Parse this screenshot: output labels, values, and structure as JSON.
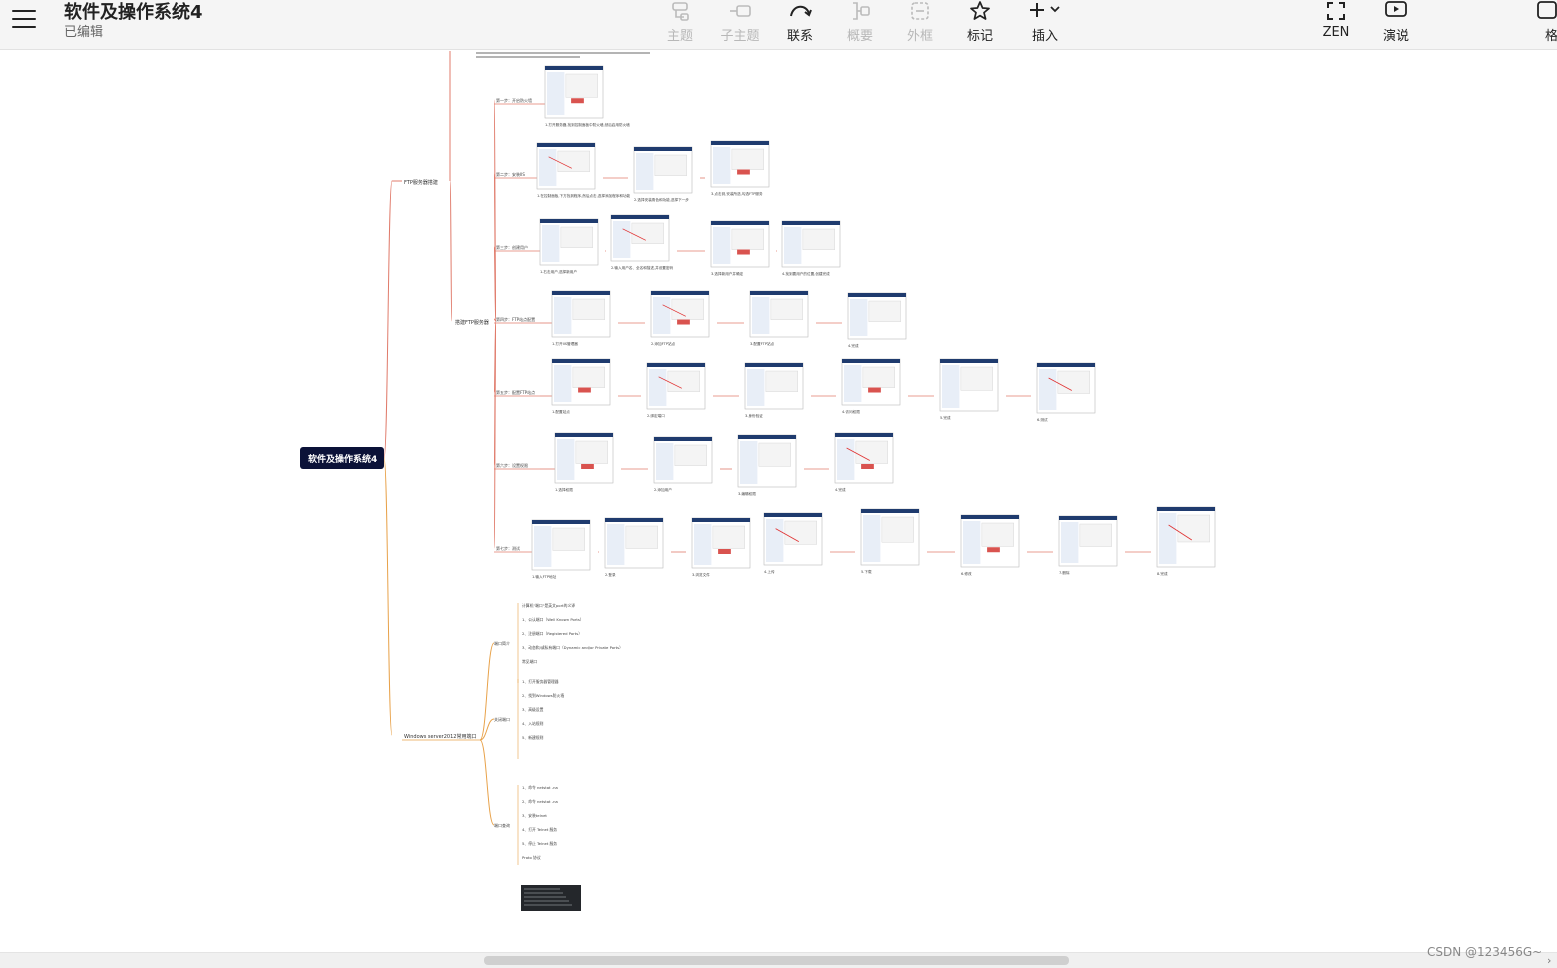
{
  "header": {
    "title": "软件及操作系统4",
    "status": "已编辑"
  },
  "toolbar": {
    "items": [
      {
        "label": "主题",
        "icon": "topic-icon",
        "enabled": false
      },
      {
        "label": "子主题",
        "icon": "subtopic-icon",
        "enabled": false
      },
      {
        "label": "联系",
        "icon": "relationship-icon",
        "enabled": true
      },
      {
        "label": "概要",
        "icon": "summary-icon",
        "enabled": false
      },
      {
        "label": "外框",
        "icon": "boundary-icon",
        "enabled": false
      },
      {
        "label": "标记",
        "icon": "star-icon",
        "enabled": true
      },
      {
        "label": "插入",
        "icon": "plus-icon",
        "enabled": true
      }
    ],
    "right_items": [
      {
        "label": "ZEN",
        "icon": "fullscreen-icon"
      },
      {
        "label": "演说",
        "icon": "presentation-icon"
      }
    ],
    "edge_label": "格"
  },
  "mindmap": {
    "root": "软件及操作系统4",
    "branches": [
      {
        "label": "FTP服务器搭建",
        "sub": "搭建FTP服务器",
        "steps": [
          {
            "label": "第一步：开启防火墙",
            "captions": [
              "1.打开服务器,找到控制面板中防火墙,然后启用防火墙"
            ]
          },
          {
            "label": "第二步：安装IIS",
            "captions": [
              "1.在控制面板,下方找到程序,然后点击,选择添加程序和功能",
              "2.选择安装角色和功能,选择下一步",
              "3.点击到,安装所选,勾选FTP服务"
            ]
          },
          {
            "label": "第三步：创建用户",
            "captions": [
              "1.右击用户,选择新用户",
              "2.输入用户名、全名和描述,并设置密码",
              "3.选择新用户并确定",
              "4.找到要用户的位置,创建完成"
            ]
          },
          {
            "label": "第四步：FTP站点配置",
            "captions": [
              "1.打开IIS管理器",
              "2.添加FTP站点",
              "3.配置FTP站点",
              "4.完成"
            ]
          },
          {
            "label": "第五步：配置FTP站点",
            "captions": [
              "1.配置站点",
              "2.绑定端口",
              "3.身份验证",
              "4.访问权限",
              "5.完成",
              "6.测试"
            ]
          },
          {
            "label": "第六步：设置权限",
            "captions": [
              "1.选择权限",
              "2.添加用户",
              "3.编辑权限",
              "4.完成"
            ]
          },
          {
            "label": "第七步：测试",
            "captions": [
              "1.输入FTP地址",
              "2.登录",
              "3.浏览文件",
              "4.上传",
              "5.下载",
              "6.修改",
              "7.删除",
              "8.完成"
            ]
          }
        ]
      },
      {
        "label": "Windows server2012常用端口",
        "groups": [
          {
            "label": "端口简介",
            "lines": [
              "计算机\"端口\"是英文port的义译",
              "1、公认端口（Well Known Ports）",
              "2、注册端口（Registered Ports）",
              "3、动态和/或私有端口（Dynamic and/or Private Ports）",
              "常见端口"
            ]
          },
          {
            "label": "关闭端口",
            "lines": [
              "1、打开服务器管理器",
              "2、找到Windows防火墙",
              "3、高级设置",
              "4、入站规则",
              "5、新建规则"
            ]
          },
          {
            "label": "端口查询",
            "lines": [
              "1、命令 netstat -na",
              "2、命令 netstat -na",
              "3、安装telnet",
              "4、打开 Telnet 服务",
              "5、停止 Telnet 服务",
              "Proto 协议"
            ]
          }
        ]
      }
    ]
  },
  "watermark": "CSDN @123456G~"
}
